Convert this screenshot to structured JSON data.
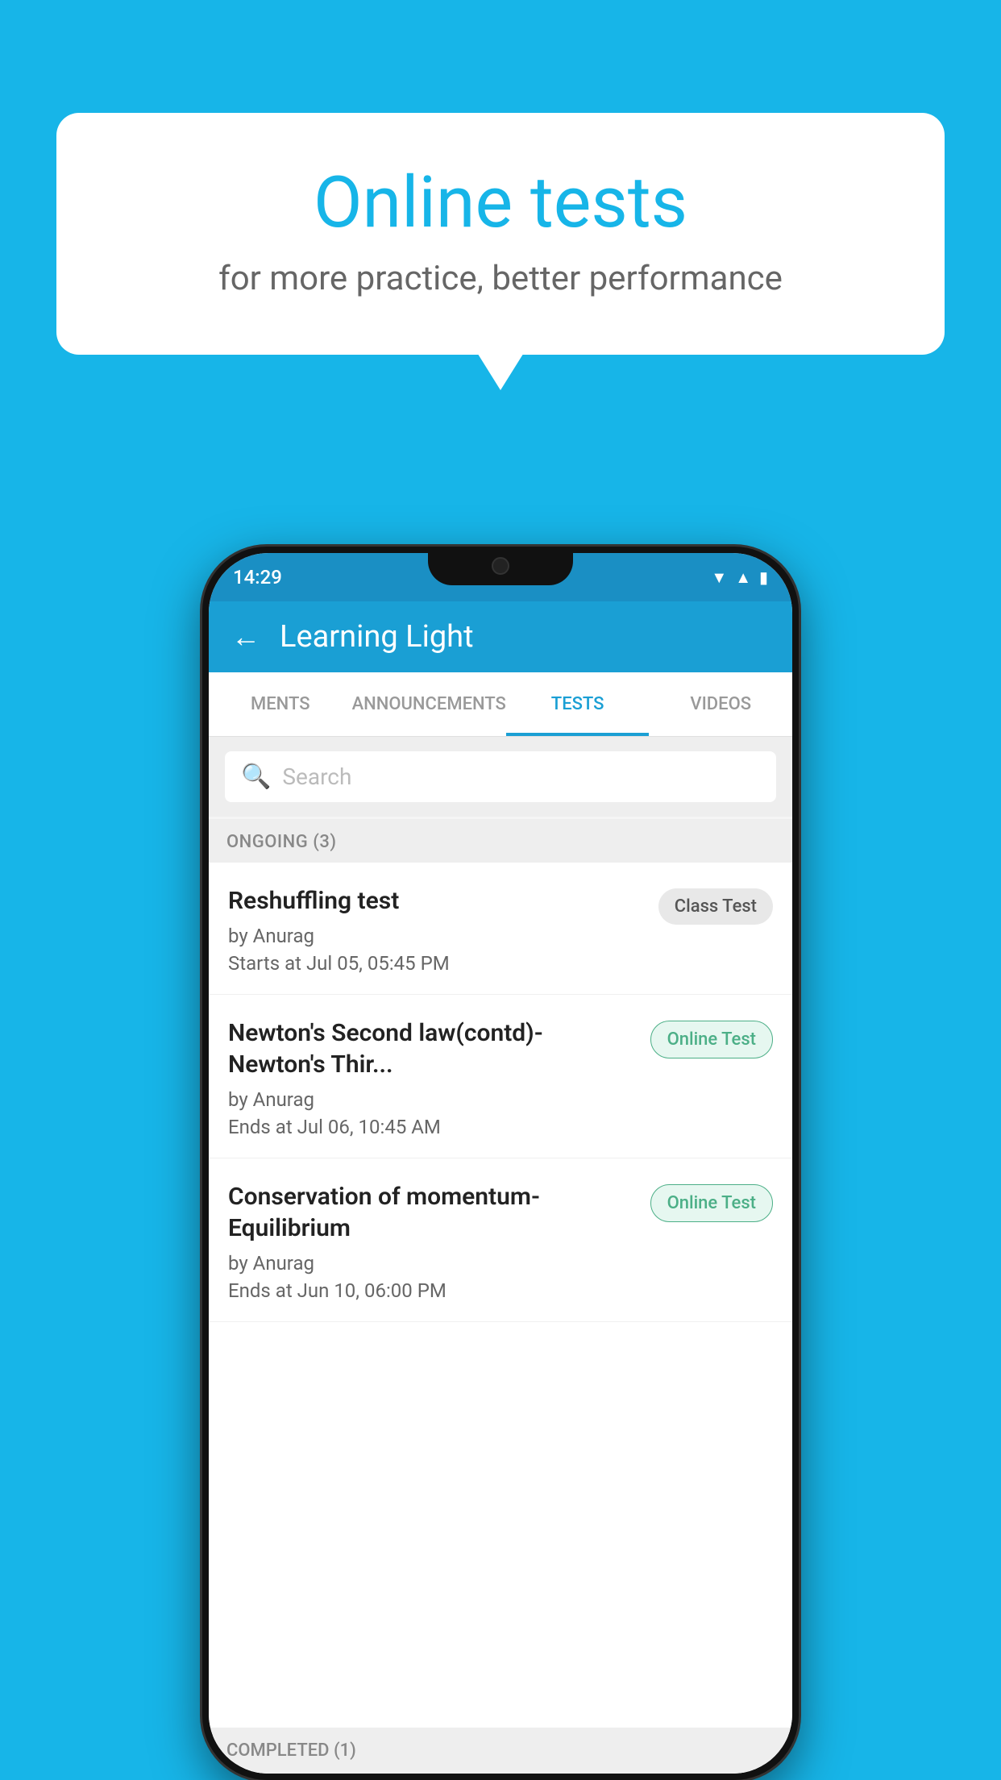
{
  "background_color": "#17b5e8",
  "bubble": {
    "title": "Online tests",
    "subtitle": "for more practice, better performance"
  },
  "phone": {
    "status_bar": {
      "time": "14:29",
      "icons": [
        "wifi",
        "signal",
        "battery"
      ]
    },
    "app_header": {
      "back_label": "←",
      "title": "Learning Light"
    },
    "tabs": [
      {
        "label": "MENTS",
        "active": false
      },
      {
        "label": "ANNOUNCEMENTS",
        "active": false
      },
      {
        "label": "TESTS",
        "active": true
      },
      {
        "label": "VIDEOS",
        "active": false
      }
    ],
    "search": {
      "placeholder": "Search"
    },
    "ongoing_section": {
      "label": "ONGOING (3)"
    },
    "tests": [
      {
        "name": "Reshuffling test",
        "by": "by Anurag",
        "date_label": "Starts at",
        "date": "Jul 05, 05:45 PM",
        "badge": "Class Test",
        "badge_type": "class"
      },
      {
        "name": "Newton's Second law(contd)-Newton's Thir...",
        "by": "by Anurag",
        "date_label": "Ends at",
        "date": "Jul 06, 10:45 AM",
        "badge": "Online Test",
        "badge_type": "online"
      },
      {
        "name": "Conservation of momentum-Equilibrium",
        "by": "by Anurag",
        "date_label": "Ends at",
        "date": "Jun 10, 06:00 PM",
        "badge": "Online Test",
        "badge_type": "online"
      }
    ],
    "completed_section": {
      "label": "COMPLETED (1)"
    }
  }
}
